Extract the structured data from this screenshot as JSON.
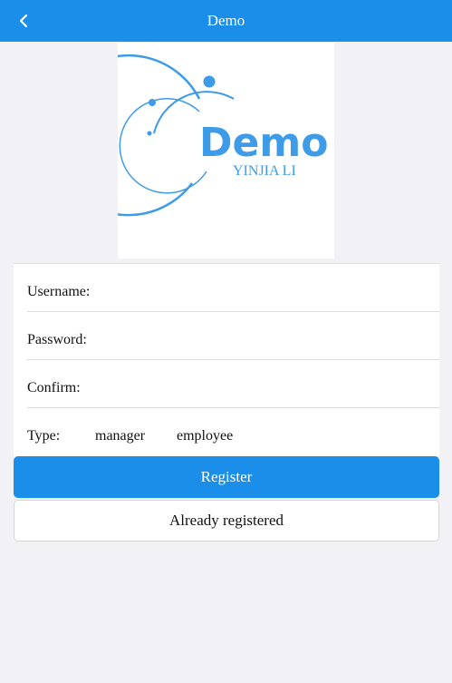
{
  "header": {
    "title": "Demo",
    "back_icon": "chevron-left-icon"
  },
  "logo": {
    "word": "Demo",
    "subtitle": "YINJIA LI",
    "color": "#3d9be8"
  },
  "form": {
    "username_label": "Username:",
    "username_value": "",
    "password_label": "Password:",
    "password_value": "",
    "confirm_label": "Confirm:",
    "confirm_value": "",
    "type_label": "Type:",
    "type_options": [
      "manager",
      "employee"
    ]
  },
  "buttons": {
    "register": "Register",
    "already_registered": "Already registered"
  },
  "colors": {
    "accent": "#1a8ee9",
    "background": "#f2f2f6"
  }
}
